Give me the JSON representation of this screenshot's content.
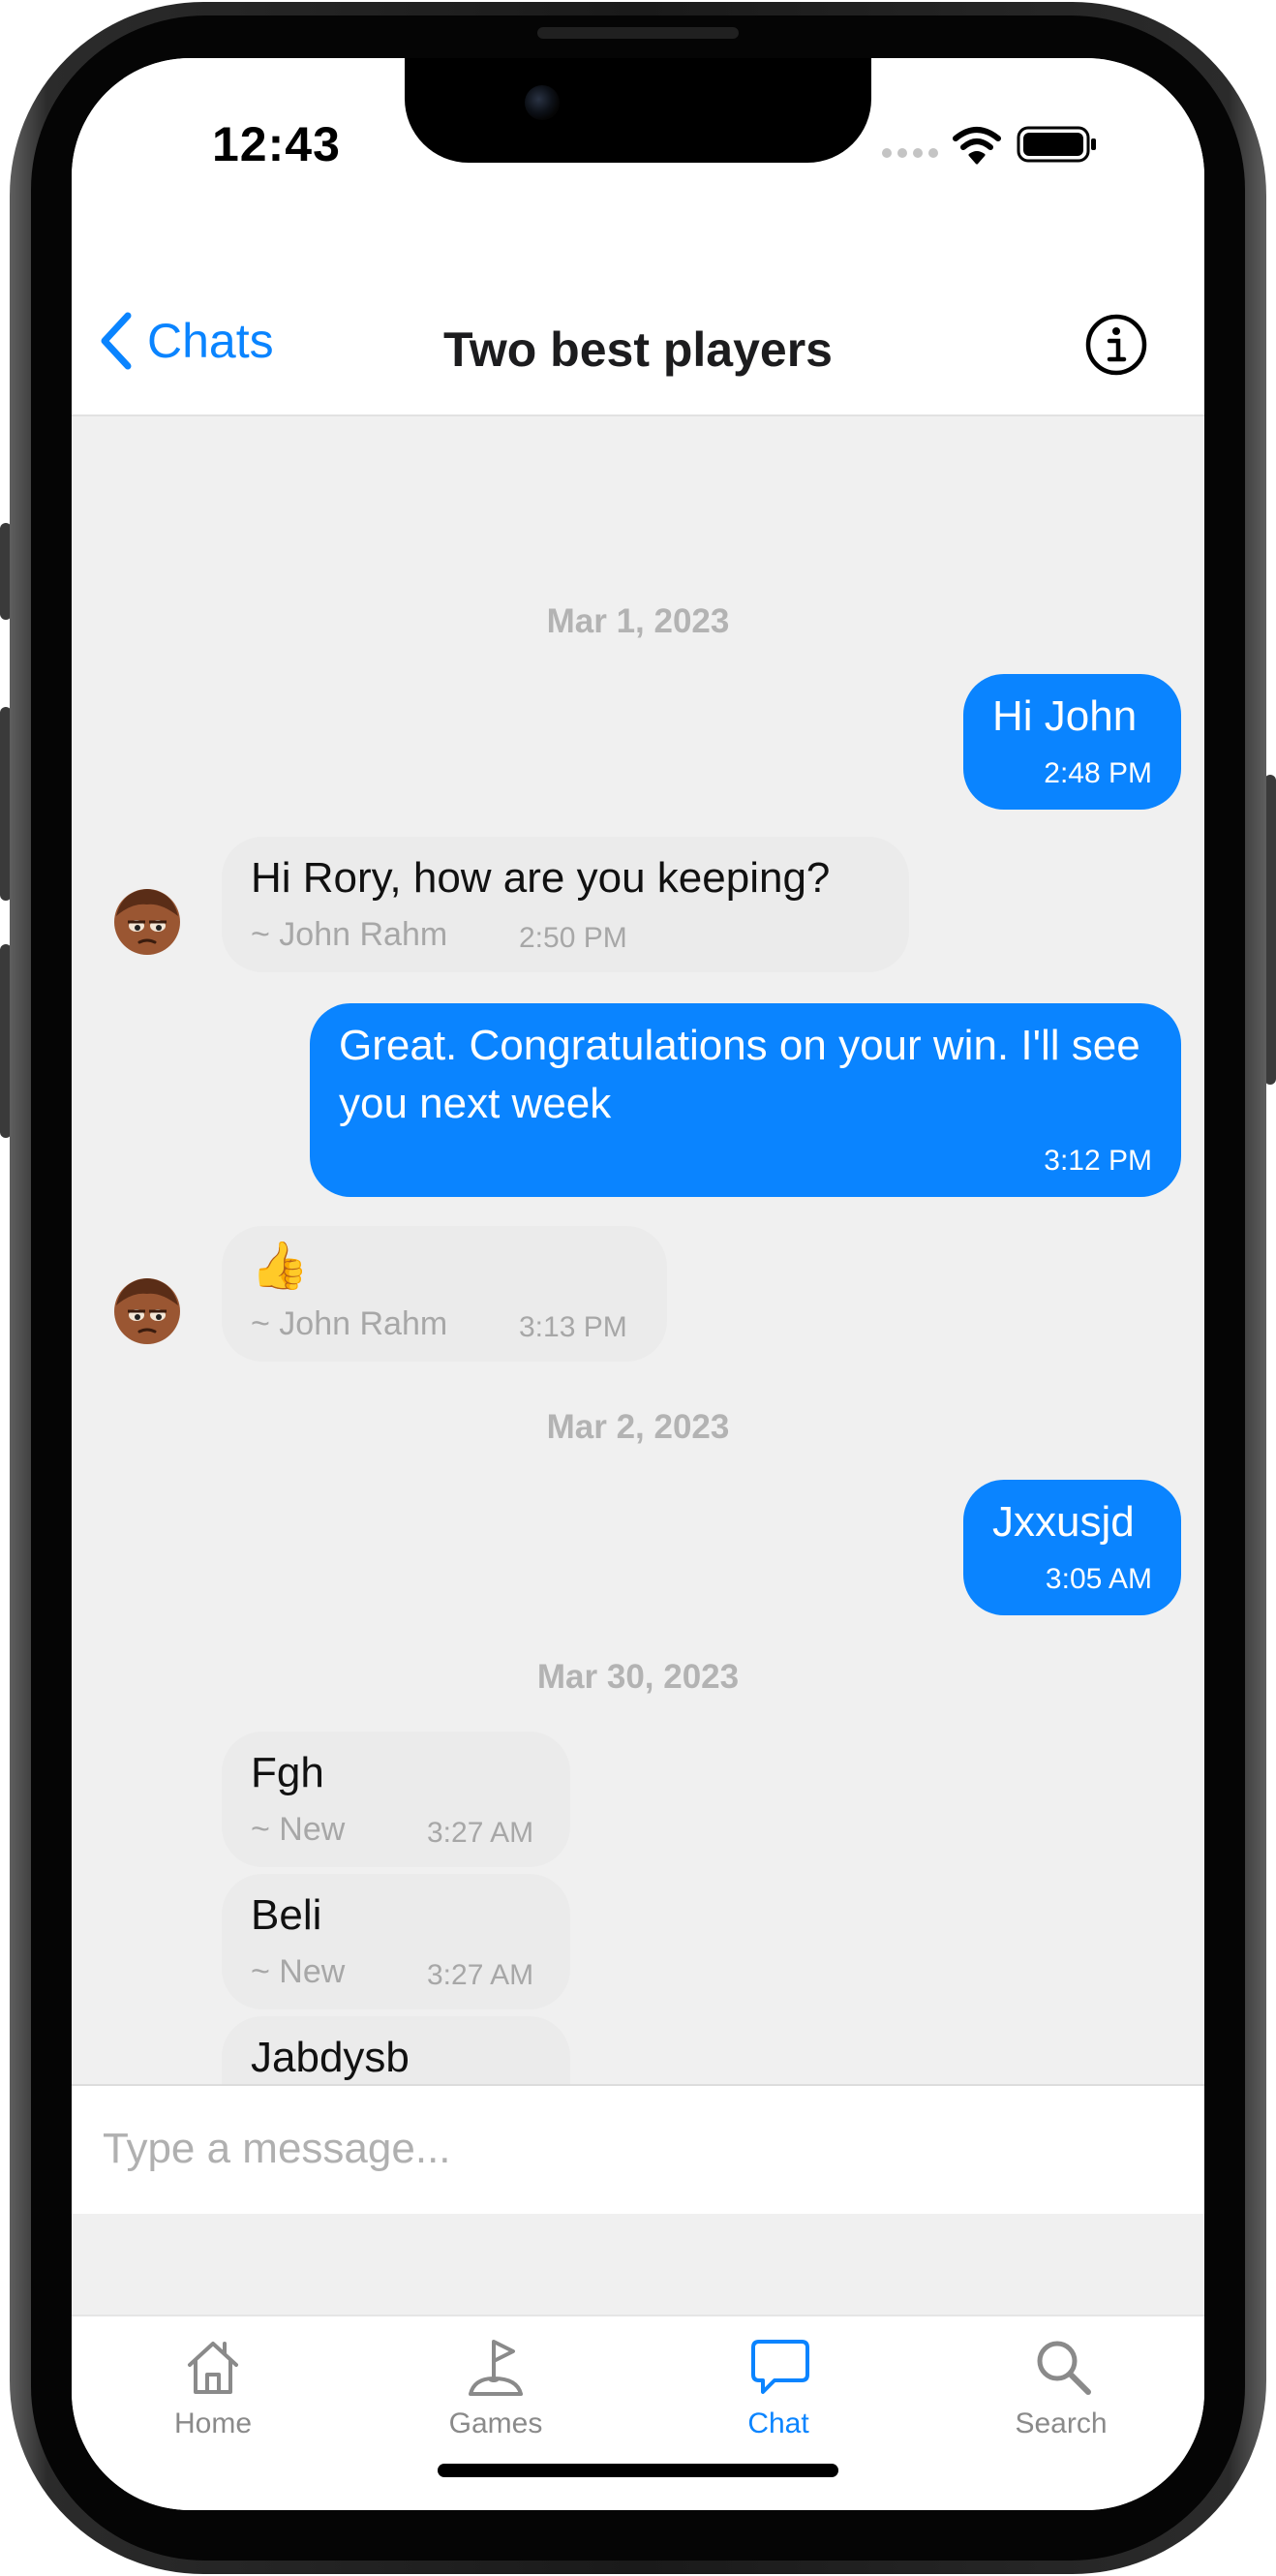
{
  "status_bar": {
    "time": "12:43"
  },
  "nav": {
    "back_label": "Chats",
    "title": "Two best players"
  },
  "messages": [
    {
      "date": "Mar 1, 2023"
    },
    {
      "text": "Hi John",
      "time": "2:48 PM"
    },
    {
      "text": "Hi Rory, how are you keeping?",
      "sender": "~ John Rahm",
      "time": "2:50 PM"
    },
    {
      "text": "Great. Congratulations on your win. I'll see you next week",
      "time": "3:12 PM"
    },
    {
      "text": "👍",
      "sender": "~ John Rahm",
      "time": "3:13 PM"
    },
    {
      "date": "Mar 2, 2023"
    },
    {
      "text": "Jxxusjd",
      "time": "3:05 AM"
    },
    {
      "date": "Mar 30, 2023"
    },
    {
      "text": "Fgh",
      "sender": "~ New",
      "time": "3:27 AM"
    },
    {
      "text": "Beli",
      "sender": "~ New",
      "time": "3:27 AM"
    },
    {
      "text": "Jabdysb"
    }
  ],
  "composer": {
    "placeholder": "Type a message..."
  },
  "tabs": [
    {
      "label": "Home",
      "icon": "house-icon"
    },
    {
      "label": "Games",
      "icon": "golf-flag-icon"
    },
    {
      "label": "Chat",
      "icon": "chat-bubble-icon",
      "active": true
    },
    {
      "label": "Search",
      "icon": "magnifier-icon"
    }
  ],
  "colors": {
    "accent": "#0a84ff",
    "outgoing_bubble": "#0a84ff",
    "incoming_bubble": "#ebebeb",
    "chat_background": "#f0f0f0",
    "inactive_tab": "#8a8a8a"
  }
}
